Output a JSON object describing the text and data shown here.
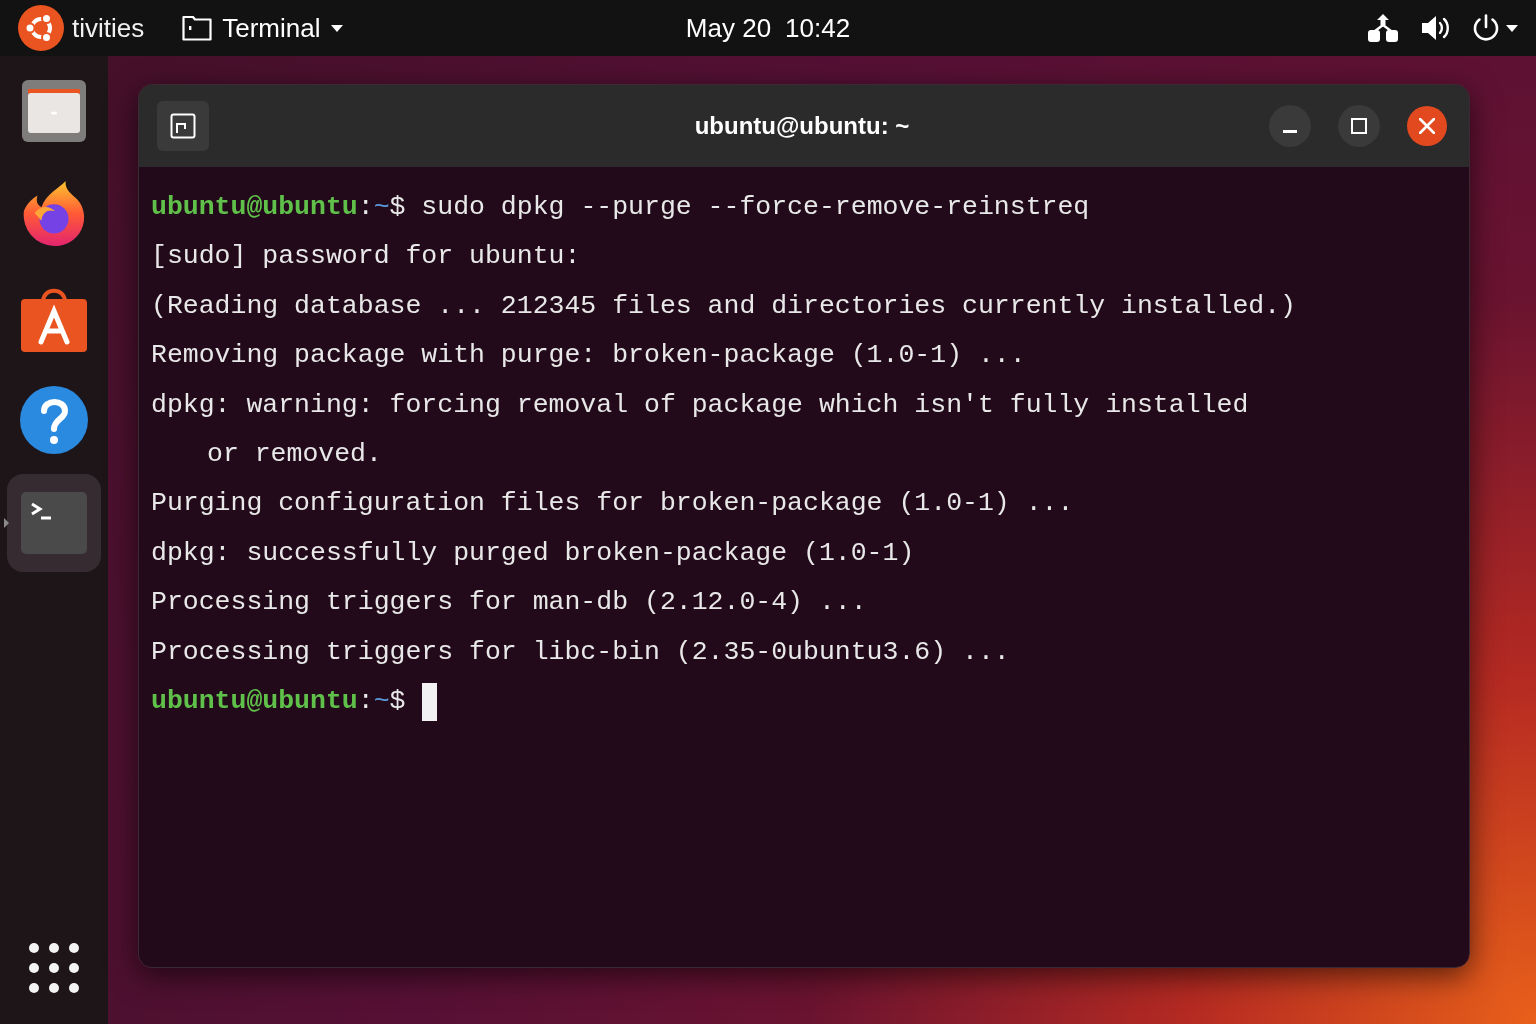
{
  "top_bar": {
    "activities": "tivities",
    "app_menu": {
      "label": "Terminal"
    },
    "clock": {
      "date": "May 20",
      "time": "10:42"
    }
  },
  "dock": {
    "items": [
      {
        "kind": "files",
        "active": false
      },
      {
        "kind": "browser",
        "active": false
      },
      {
        "kind": "software",
        "active": false
      },
      {
        "kind": "help",
        "active": false
      },
      {
        "kind": "terminal",
        "active": true
      }
    ]
  },
  "window": {
    "title": "ubuntu@ubuntu: ~"
  },
  "terminal": {
    "lines": [
      {
        "kind": "prompt",
        "user_host": "ubuntu@ubuntu",
        "colon": ":",
        "cwd": "~",
        "prompt_char": "$",
        "command": "sudo dpkg --purge --force-remove-reinstreq"
      },
      {
        "kind": "output",
        "text": "[sudo] password for ubuntu:"
      },
      {
        "kind": "output",
        "text": "(Reading database ... 212345 files and directories currently installed.)"
      },
      {
        "kind": "output",
        "text": "Removing package with purge: broken-package (1.0-1) ..."
      },
      {
        "kind": "output",
        "text": "dpkg: warning: forcing removal of package which isn't fully installed"
      },
      {
        "kind": "continuation",
        "text": "or removed."
      },
      {
        "kind": "output",
        "text": "Purging configuration files for broken-package (1.0-1) ..."
      },
      {
        "kind": "output",
        "text": "dpkg: successfully purged broken-package (1.0-1)"
      },
      {
        "kind": "output",
        "text": "Processing triggers for man-db (2.12.0-4) ..."
      },
      {
        "kind": "output",
        "text": "Processing triggers for libc-bin (2.35-0ubuntu3.6) ..."
      },
      {
        "kind": "prompt",
        "user_host": "ubuntu@ubuntu",
        "colon": ":",
        "cwd": "~",
        "prompt_char": "$",
        "cursor": true
      }
    ]
  }
}
